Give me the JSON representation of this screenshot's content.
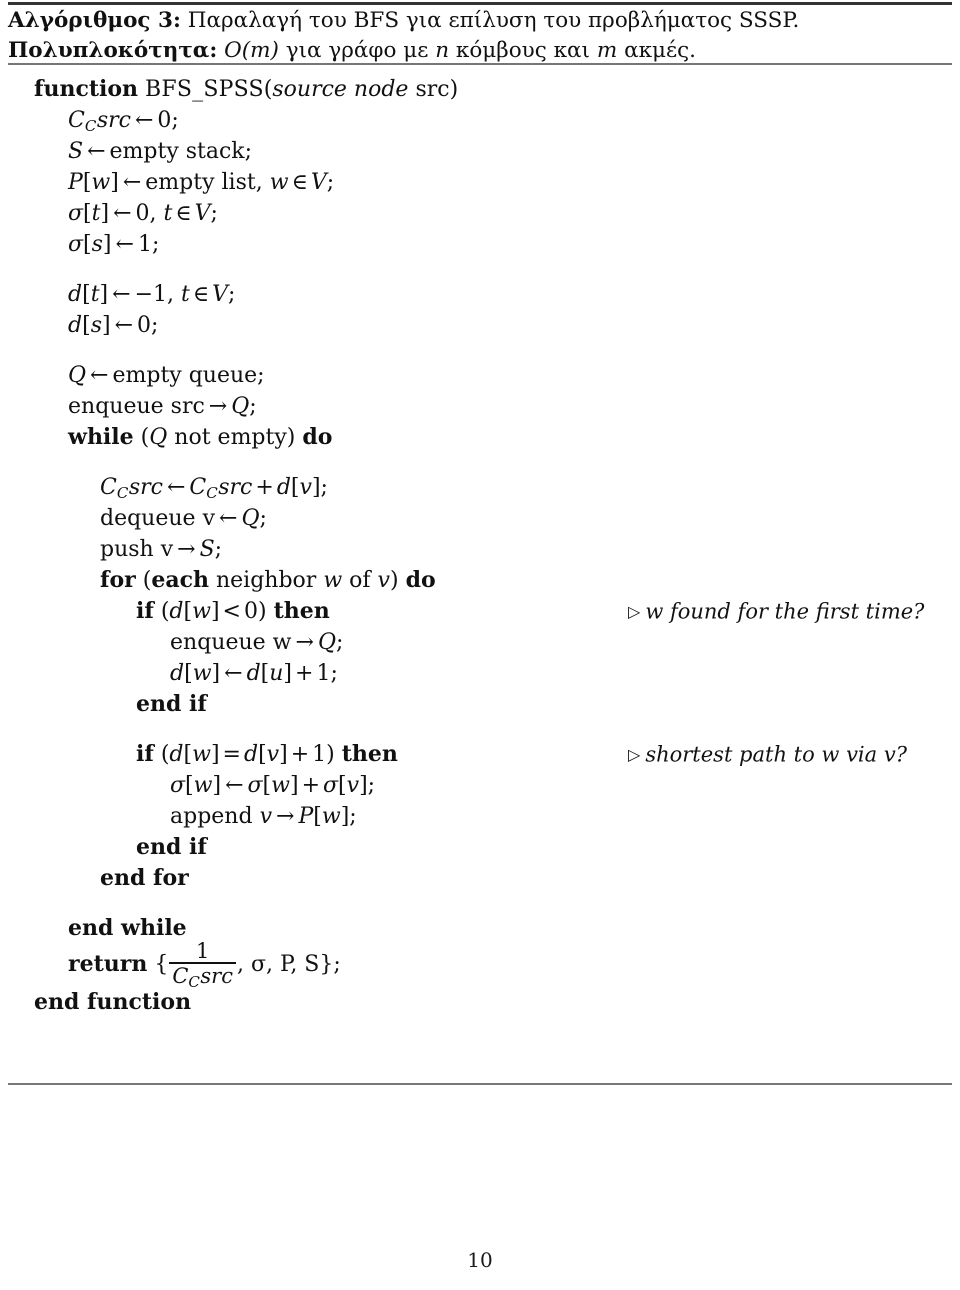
{
  "document": {
    "page_number": "10",
    "caption": {
      "label": "Αλγόριθμος 3:",
      "title": "Παραλαγή του BFS για επίλυση του προβλήματος SSSP.",
      "complexity_label": "Πολυπλοκότητα:",
      "complexity_math": "O(m)",
      "complexity_rest_1": "για γράφο με",
      "complexity_var_n": "n",
      "complexity_rest_2": "κόμβους και",
      "complexity_var_m": "m",
      "complexity_rest_3": "ακμές."
    },
    "algorithm": {
      "signature": {
        "keyword": "function",
        "name": "BFS_SPSS",
        "open_paren": "(",
        "param_type": "source node",
        "param_name": "src",
        "close_paren": ")"
      },
      "lines": [
        {
          "id": "init-c",
          "text": "C_C src ← 0;"
        },
        {
          "id": "init-s",
          "text": "S ← empty stack;"
        },
        {
          "id": "init-p",
          "text": "P[w] ← empty list, w ∈ V;"
        },
        {
          "id": "init-sigma-t",
          "text": "σ[t] ← 0, t ∈ V;"
        },
        {
          "id": "init-sigma-s",
          "text": "σ[s] ← 1;"
        },
        {
          "id": "init-d-t",
          "text": "d[t] ← −1, t ∈ V;"
        },
        {
          "id": "init-d-s",
          "text": "d[s] ← 0;"
        },
        {
          "id": "init-q",
          "text": "Q ← empty queue;"
        },
        {
          "id": "enqueue-src",
          "text": "enqueue src → Q;"
        },
        {
          "id": "while-head",
          "text": "while (Q not empty) do"
        },
        {
          "id": "accum-c",
          "text": "C_C src ← C_C src + d[v];"
        },
        {
          "id": "dequeue-v",
          "text": "dequeue v ← Q;"
        },
        {
          "id": "push-v",
          "text": "push v → S;"
        },
        {
          "id": "for-head",
          "text": "for (each neighbor w of v) do"
        },
        {
          "id": "if1-head",
          "text": "if (d[w] < 0) then"
        },
        {
          "id": "enqueue-w",
          "text": "enqueue w → Q;"
        },
        {
          "id": "set-dw",
          "text": "d[w] ← d[u] + 1;"
        },
        {
          "id": "end-if-1",
          "text": "end if"
        },
        {
          "id": "if2-head",
          "text": "if (d[w] = d[v] + 1) then"
        },
        {
          "id": "set-sigma-w",
          "text": "σ[w] ← σ[w] + σ[v];"
        },
        {
          "id": "append-v",
          "text": "append v → P[w];"
        },
        {
          "id": "end-if-2",
          "text": "end if"
        },
        {
          "id": "end-for",
          "text": "end for"
        },
        {
          "id": "end-while",
          "text": "end while"
        },
        {
          "id": "return",
          "text": "return { 1 / C_C src , σ, P, S };"
        },
        {
          "id": "end-function",
          "text": "end function"
        }
      ],
      "tokens": {
        "kw_while": "while",
        "kw_do": "do",
        "kw_for": "for",
        "kw_each": "each",
        "kw_if": "if",
        "kw_then": "then",
        "kw_end_if": "end if",
        "kw_end_for": "end for",
        "kw_end_while": "end while",
        "kw_end_function": "end function",
        "kw_return": "return",
        "lit_empty_stack": "empty stack;",
        "lit_empty_list": "empty list,",
        "lit_empty_queue": "empty queue;",
        "lit_enqueue": "enqueue",
        "lit_dequeue": "dequeue",
        "lit_push": "push",
        "lit_append": "append",
        "lit_src": "src",
        "lit_v": "v",
        "lit_w": "w",
        "lit_not_empty": "not empty)",
        "lit_neighbor": "neighbor",
        "lit_of": "of",
        "arrow_left": "←",
        "arrow_right": "→",
        "in_symbol": "∈",
        "plus": "+",
        "less_than": "<",
        "equals": "=",
        "zero": "0;",
        "one_semi": "1;",
        "minus_one": "−1,",
        "zero_comma": "0,",
        "semi": ";",
        "triangle": "▷"
      },
      "comments": [
        {
          "id": "comment-first-time",
          "text": "w found for the first time?"
        },
        {
          "id": "comment-shortest",
          "text": "shortest path to w via v?"
        }
      ],
      "return_expr": {
        "open_brace": "{",
        "numerator": "1",
        "denominator": "C_C src",
        "tail": ", σ, P, S};"
      }
    }
  }
}
